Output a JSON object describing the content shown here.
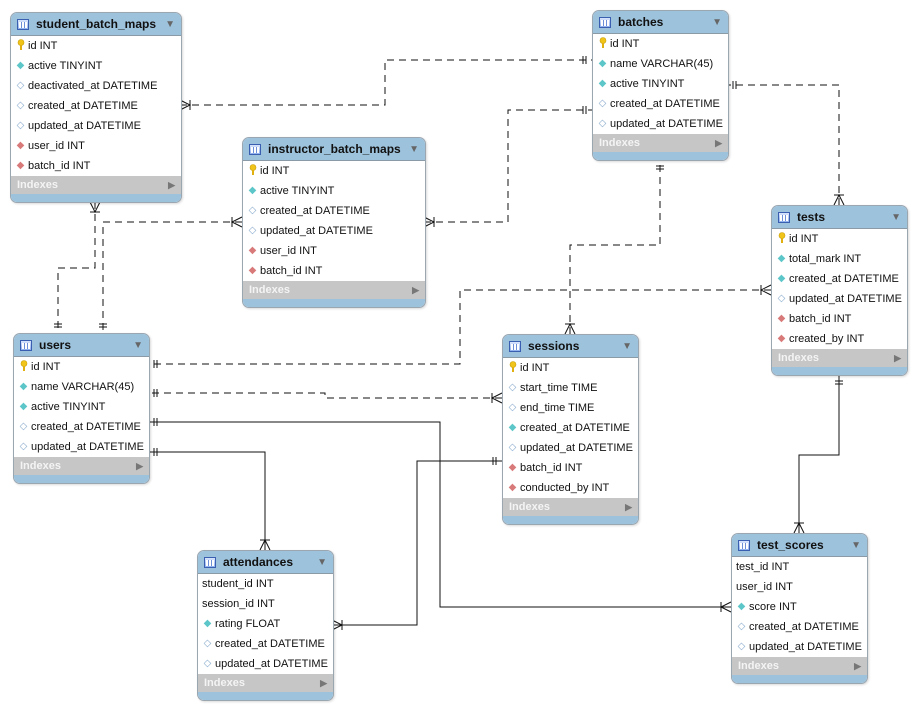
{
  "indexes_label": "Indexes",
  "tables": [
    {
      "name": "student_batch_maps",
      "columns": [
        {
          "icon": "primary-key",
          "text": "id INT"
        },
        {
          "icon": "column-not-null",
          "text": "active TINYINT"
        },
        {
          "icon": "column-nullable",
          "text": "deactivated_at DATETIME"
        },
        {
          "icon": "column-nullable",
          "text": "created_at DATETIME"
        },
        {
          "icon": "column-nullable",
          "text": "updated_at DATETIME"
        },
        {
          "icon": "foreign-key",
          "text": "user_id INT"
        },
        {
          "icon": "foreign-key",
          "text": "batch_id INT"
        }
      ]
    },
    {
      "name": "batches",
      "columns": [
        {
          "icon": "primary-key",
          "text": "id INT"
        },
        {
          "icon": "column-not-null",
          "text": "name VARCHAR(45)"
        },
        {
          "icon": "column-not-null",
          "text": "active TINYINT"
        },
        {
          "icon": "column-nullable",
          "text": "created_at DATETIME"
        },
        {
          "icon": "column-nullable",
          "text": "updated_at DATETIME"
        }
      ]
    },
    {
      "name": "instructor_batch_maps",
      "columns": [
        {
          "icon": "primary-key",
          "text": "id INT"
        },
        {
          "icon": "column-not-null",
          "text": "active TINYINT"
        },
        {
          "icon": "column-nullable",
          "text": "created_at DATETIME"
        },
        {
          "icon": "column-nullable",
          "text": "updated_at DATETIME"
        },
        {
          "icon": "foreign-key",
          "text": "user_id INT"
        },
        {
          "icon": "foreign-key",
          "text": "batch_id INT"
        }
      ]
    },
    {
      "name": "tests",
      "columns": [
        {
          "icon": "primary-key",
          "text": "id INT"
        },
        {
          "icon": "column-not-null",
          "text": "total_mark INT"
        },
        {
          "icon": "column-not-null",
          "text": "created_at DATETIME"
        },
        {
          "icon": "column-nullable",
          "text": "updated_at DATETIME"
        },
        {
          "icon": "foreign-key",
          "text": "batch_id INT"
        },
        {
          "icon": "foreign-key",
          "text": "created_by INT"
        }
      ]
    },
    {
      "name": "users",
      "columns": [
        {
          "icon": "primary-key",
          "text": "id INT"
        },
        {
          "icon": "column-not-null",
          "text": "name VARCHAR(45)"
        },
        {
          "icon": "column-not-null",
          "text": "active TINYINT"
        },
        {
          "icon": "column-nullable",
          "text": "created_at DATETIME"
        },
        {
          "icon": "column-nullable",
          "text": "updated_at DATETIME"
        }
      ]
    },
    {
      "name": "sessions",
      "columns": [
        {
          "icon": "primary-key",
          "text": "id INT"
        },
        {
          "icon": "column-nullable",
          "text": "start_time TIME"
        },
        {
          "icon": "column-nullable",
          "text": "end_time TIME"
        },
        {
          "icon": "column-not-null",
          "text": "created_at DATETIME"
        },
        {
          "icon": "column-nullable",
          "text": "updated_at DATETIME"
        },
        {
          "icon": "foreign-key",
          "text": "batch_id INT"
        },
        {
          "icon": "foreign-key",
          "text": "conducted_by INT"
        }
      ]
    },
    {
      "name": "attendances",
      "columns": [
        {
          "icon": "none",
          "text": "student_id INT"
        },
        {
          "icon": "none",
          "text": "session_id INT"
        },
        {
          "icon": "column-not-null",
          "text": "rating FLOAT"
        },
        {
          "icon": "column-nullable",
          "text": "created_at DATETIME"
        },
        {
          "icon": "column-nullable",
          "text": "updated_at DATETIME"
        }
      ]
    },
    {
      "name": "test_scores",
      "columns": [
        {
          "icon": "none",
          "text": "test_id INT"
        },
        {
          "icon": "none",
          "text": "user_id INT"
        },
        {
          "icon": "column-not-null",
          "text": "score INT"
        },
        {
          "icon": "column-nullable",
          "text": "created_at DATETIME"
        },
        {
          "icon": "column-nullable",
          "text": "updated_at DATETIME"
        }
      ]
    }
  ],
  "relationships": [
    {
      "from": "student_batch_maps",
      "to": "batches",
      "identifying": false
    },
    {
      "from": "instructor_batch_maps",
      "to": "batches",
      "identifying": false
    },
    {
      "from": "student_batch_maps",
      "to": "users",
      "identifying": false
    },
    {
      "from": "instructor_batch_maps",
      "to": "users",
      "identifying": false
    },
    {
      "from": "sessions",
      "to": "batches",
      "identifying": false
    },
    {
      "from": "tests",
      "to": "batches",
      "identifying": false
    },
    {
      "from": "tests",
      "to": "users",
      "identifying": false
    },
    {
      "from": "sessions",
      "to": "users",
      "identifying": false
    },
    {
      "from": "test_scores",
      "to": "users",
      "identifying": true
    },
    {
      "from": "attendances",
      "to": "users",
      "identifying": true
    },
    {
      "from": "attendances",
      "to": "sessions",
      "identifying": true
    },
    {
      "from": "test_scores",
      "to": "tests",
      "identifying": true
    }
  ]
}
